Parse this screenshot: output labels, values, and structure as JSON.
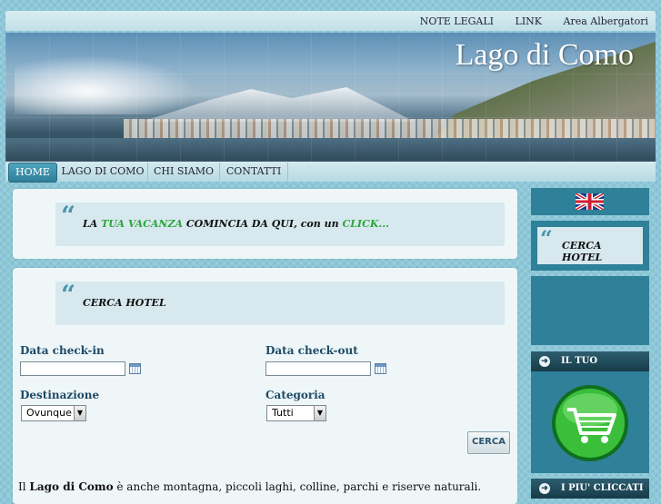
{
  "top_nav": {
    "note_legali": "NOTE LEGALI",
    "link": "LINK",
    "area": "Area Albergatori"
  },
  "banner": {
    "title": "Lago di Como"
  },
  "menu": {
    "items": [
      "HOME",
      "LAGO DI COMO",
      "CHI SIAMO",
      "CONTATTI"
    ],
    "active": "HOME"
  },
  "promo": {
    "quote_mark": "“",
    "part1": "LA ",
    "highlight": "TUA VACANZA",
    "part2": " COMINCIA DA QUI, con un ",
    "click": "CLICK..."
  },
  "search": {
    "heading": "CERCA HOTEL",
    "checkin_label": "Data check-in",
    "checkin_value": "",
    "checkout_label": "Data check-out",
    "checkout_value": "",
    "destination_label": "Destinazione",
    "destination_value": "Ovunque",
    "category_label": "Categoria",
    "category_value": "Tutti",
    "button": "CERCA"
  },
  "intro": {
    "prefix": "Il ",
    "bold": "Lago di Como",
    "rest": " è anche montagna, piccoli laghi, colline, parchi e riserve naturali."
  },
  "sidebar": {
    "search_title": "CERCA HOTEL",
    "cart_title": "IL TUO CARRELLO",
    "popular_title": "I PIU' CLICCATI"
  },
  "colors": {
    "accent": "#2f8099",
    "highlight_green": "#2aa63a",
    "label_blue": "#1d4a66"
  }
}
